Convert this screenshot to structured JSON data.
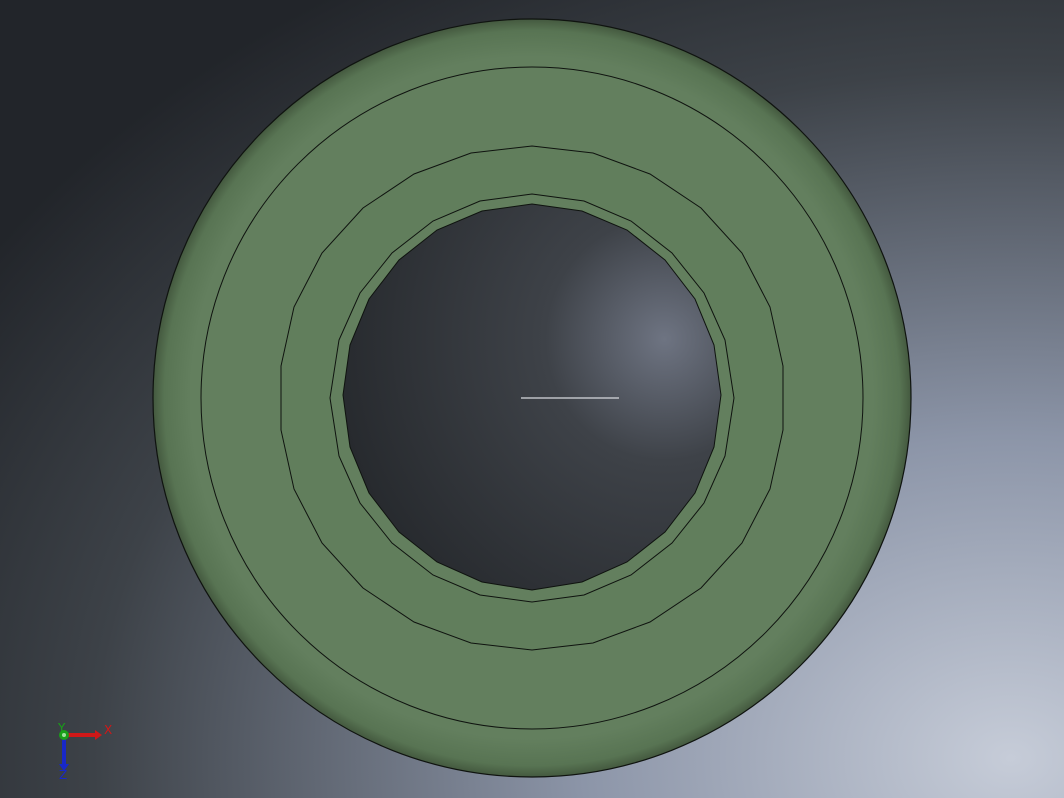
{
  "viewport": {
    "background_colors": {
      "dark": "#24272c",
      "mid": "#6f7788",
      "light": "#c2c9d6"
    },
    "model": {
      "name": "ring-part",
      "face_color": "#637f5e",
      "edge_color": "#0f130f",
      "hole_color": "#2b2e33"
    }
  },
  "triad": {
    "x_label": "X",
    "y_label": "Y",
    "z_label": "Z",
    "x_color": "#d01818",
    "y_color": "#18a018",
    "z_color": "#1828c8"
  }
}
